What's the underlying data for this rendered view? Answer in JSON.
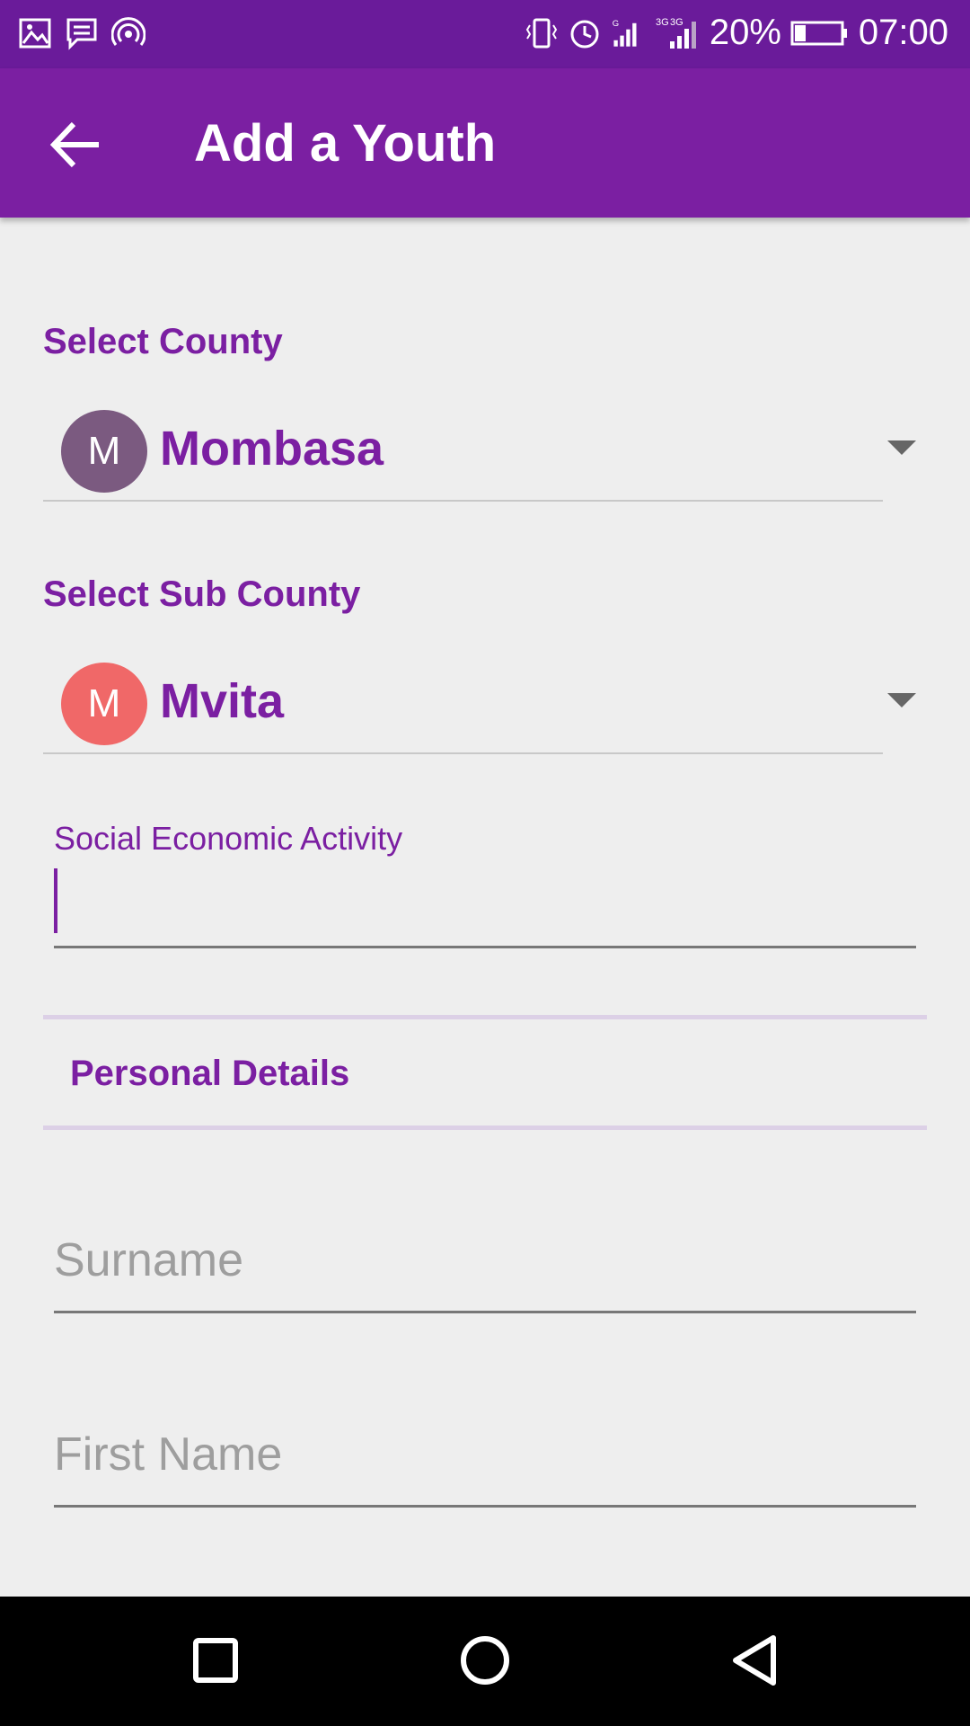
{
  "status_bar": {
    "battery": "20%",
    "time": "07:00",
    "icons_left": [
      "image-icon",
      "message-icon",
      "hotspot-icon"
    ],
    "icons_right": [
      "vibrate-icon",
      "alarm-icon",
      "signal-icon",
      "signal-icon"
    ],
    "network_labels": [
      "G",
      "3G",
      "3G"
    ]
  },
  "app_bar": {
    "title": "Add a Youth",
    "back_icon": "arrow-left-icon"
  },
  "county": {
    "label": "Select County",
    "avatar_letter": "M",
    "value": "Mombasa",
    "avatar_color": "#7b5a80"
  },
  "sub_county": {
    "label": "Select Sub County",
    "avatar_letter": "M",
    "value": "Mvita",
    "avatar_color": "#f06868"
  },
  "social_economic": {
    "label": "Social Economic Activity",
    "value": ""
  },
  "personal_details": {
    "heading": "Personal Details"
  },
  "fields": {
    "surname_placeholder": "Surname",
    "first_name_placeholder": "First Name"
  },
  "nav_bar": {
    "icons": [
      "recents-square-icon",
      "home-circle-icon",
      "back-triangle-icon"
    ]
  },
  "colors": {
    "primary": "#7b1fa2",
    "primary_dark": "#6a1b9a",
    "background": "#eeeeee"
  }
}
